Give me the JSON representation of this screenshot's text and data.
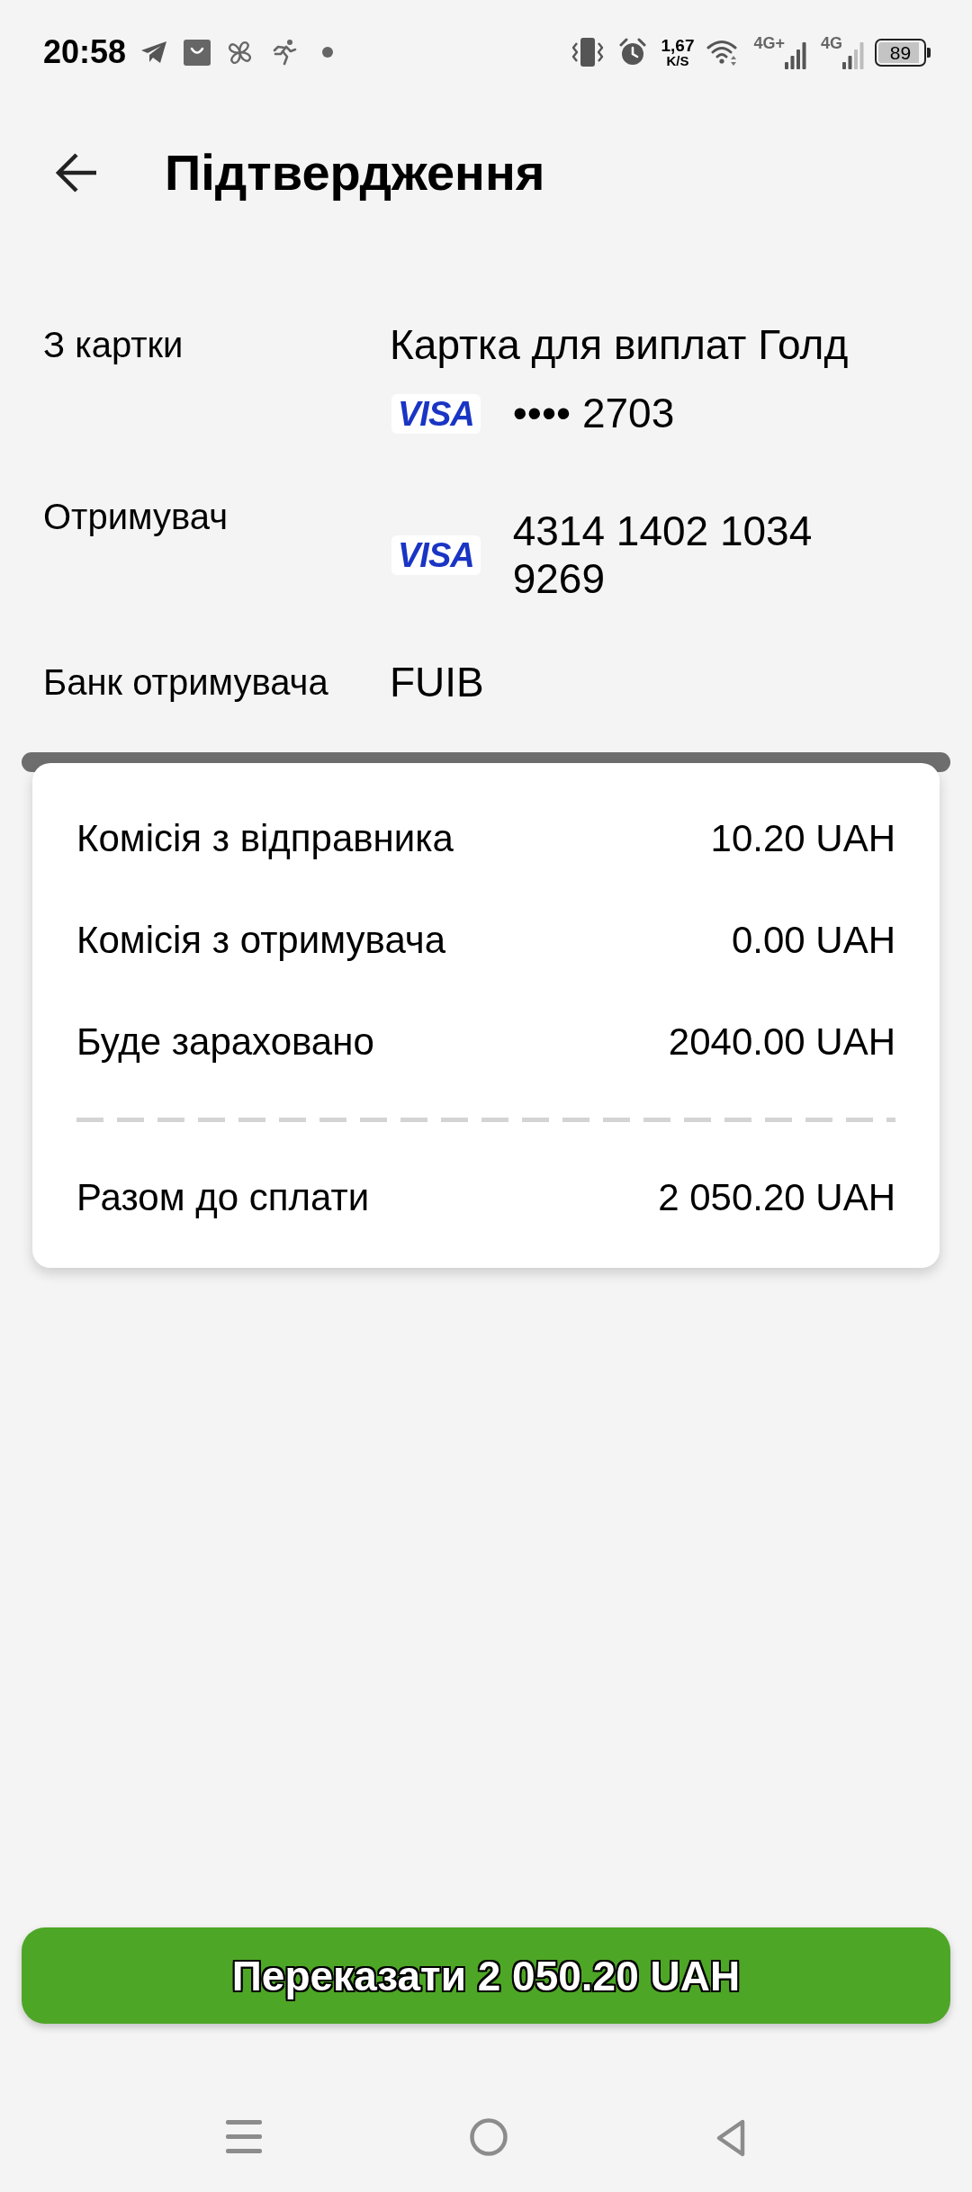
{
  "status_bar": {
    "time": "20:58",
    "network_speed": "1,67",
    "network_speed_unit": "K/S",
    "networks": [
      {
        "label": "4G+"
      },
      {
        "label": "4G"
      }
    ],
    "battery": "89"
  },
  "header": {
    "title": "Підтвердження"
  },
  "details": [
    {
      "label": "З картки",
      "lines": [
        {
          "kind": "text",
          "text": "Картка для виплат Голд"
        },
        {
          "kind": "card",
          "brand": "VISA",
          "number": "•••• 2703"
        }
      ]
    },
    {
      "label": "Отримувач",
      "lines": [
        {
          "kind": "card",
          "brand": "VISA",
          "number": "4314 1402 1034 9269"
        }
      ]
    },
    {
      "label": "Банк отримувача",
      "lines": [
        {
          "kind": "text",
          "text": "FUIB"
        }
      ]
    }
  ],
  "summary": {
    "fees": [
      {
        "label": "Комісія з відправника",
        "value": "10.20 UAH"
      },
      {
        "label": "Комісія з отримувача",
        "value": "0.00 UAH"
      },
      {
        "label": "Буде зараховано",
        "value": "2040.00 UAH"
      }
    ],
    "total": {
      "label": "Разом до сплати",
      "value": "2 050.20 UAH"
    }
  },
  "submit_button": {
    "label": "Переказати 2 050.20 UAH"
  }
}
